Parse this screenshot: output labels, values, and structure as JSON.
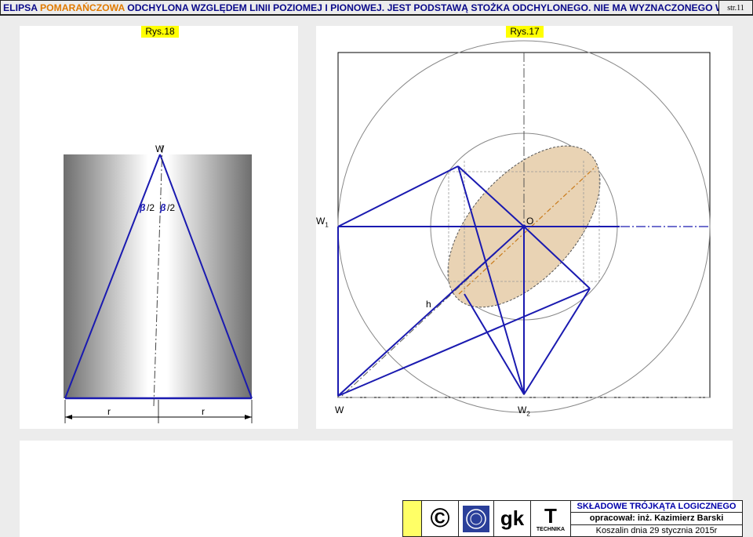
{
  "header": {
    "title_part1": "ELIPSA",
    "title_part2": "POMARAŃCZOWA",
    "title_part3": "ODCHYLONA WZGLĘDEM LINII POZIOMEJ I PIONOWEJ. JEST PODSTAWĄ STOŻKA ODCHYLONEGO. NIE MA WYZNACZONEGO WIERZCHOŁKA.",
    "page": "str.11"
  },
  "figures": {
    "left_caption": "Rys.18",
    "right_caption": "Rys.17"
  },
  "left_labels": {
    "apex": "W",
    "beta_left": "β",
    "half_left": "/2",
    "beta_right": "β",
    "half_right": "/2",
    "radius_left": "r",
    "radius_right": "r"
  },
  "right_labels": {
    "w1": "W",
    "w1_sub": "1",
    "center": "O",
    "height": "h",
    "w": "W",
    "w2": "W",
    "w2_sub": "2"
  },
  "colors": {
    "blue_line": "#1a1ab0",
    "ellipse_fill": "#e9d3b4",
    "axis_orange": "#c87a1a"
  },
  "footer": {
    "copyright": "©",
    "gk": "gk",
    "t": "T",
    "technika": "TECHNIKA",
    "row1": "SKŁADOWE TRÓJKĄTA LOGICZNEGO",
    "row2": "opracował:  inż. Kazimierz Barski",
    "row3": "Koszalin dnia 29 stycznia 2015r"
  }
}
